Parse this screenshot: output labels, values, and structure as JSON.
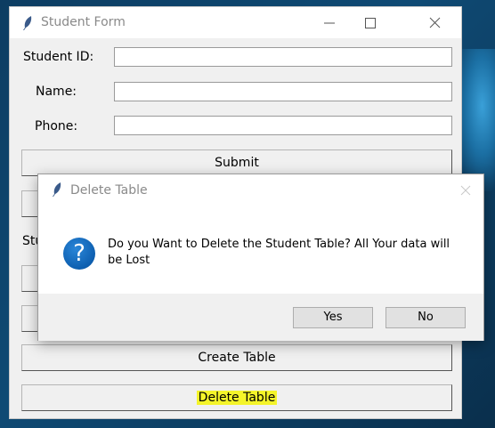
{
  "window": {
    "title": "Student Form",
    "controls": {
      "minimize_icon": "minimize-icon",
      "maximize_icon": "maximize-icon",
      "close_icon": "close-icon"
    }
  },
  "form": {
    "student_id_label": "Student ID:",
    "name_label": "Name:",
    "phone_label": "Phone:",
    "student_id_value": "",
    "name_value": "",
    "phone_value": "",
    "partial_label": "Stu"
  },
  "buttons": {
    "submit": "Submit",
    "create_table": "Create Table",
    "delete_table": "Delete Table"
  },
  "dialog": {
    "title": "Delete Table",
    "message": "Do you Want to Delete the Student Table? All Your data will be Lost",
    "icon": "question-icon",
    "yes": "Yes",
    "no": "No"
  },
  "colors": {
    "highlight": "#f4f42a",
    "question_icon": "#0d5fb0"
  }
}
